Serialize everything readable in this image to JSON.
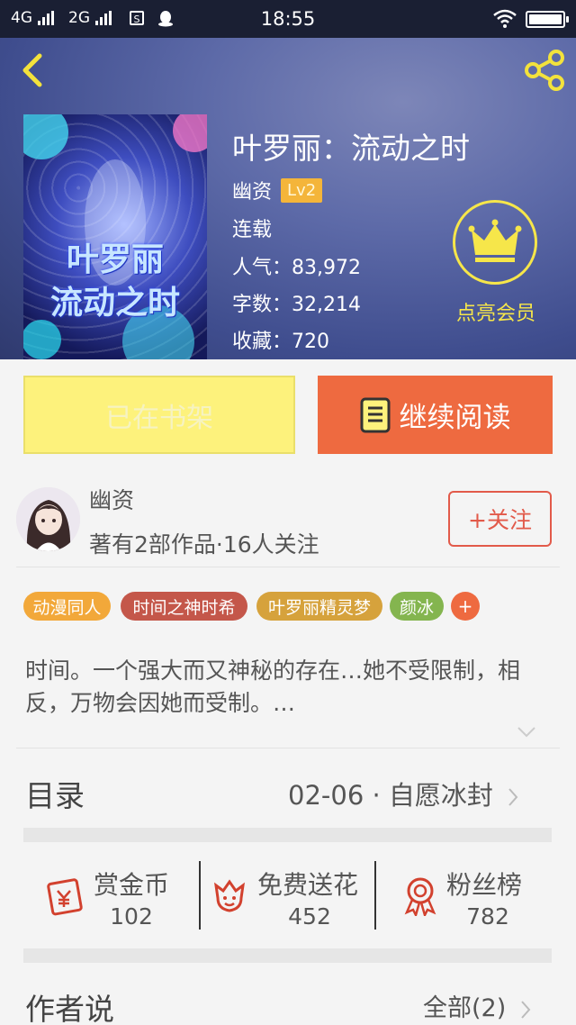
{
  "status_bar": {
    "network1": "4G",
    "network2": "2G",
    "app_icon_letter": "S",
    "time": "18:55"
  },
  "book": {
    "title": "叶罗丽：流动之时",
    "author": "幽资",
    "author_level": "Lv2",
    "status": "连载",
    "popularity": "人气：83,972",
    "word_count": "字数：32,214",
    "favorites": "收藏：720",
    "cover_text_line1": "叶罗丽",
    "cover_text_line2": "流动之时"
  },
  "vip": {
    "label": "点亮会员",
    "icon": "crown-icon"
  },
  "actions": {
    "shelf_label": "已在书架",
    "read_label": "继续阅读"
  },
  "author_card": {
    "name": "幽资",
    "summary": "著有2部作品·16人关注",
    "follow_label": "+关注"
  },
  "tags": [
    "动漫同人",
    "时间之神时希",
    "叶罗丽精灵梦",
    "颜冰"
  ],
  "tag_add": "+",
  "colors": {
    "tag1": "#f2a83a",
    "tag2": "#c4574a",
    "tag3": "#d6a23c",
    "tag4": "#84b54f",
    "accent": "#ee6a40",
    "shelf": "#fdf27c"
  },
  "description": "时间。一个强大而又神秘的存在…她不受限制，相反，万物会因她而受制。…",
  "toc": {
    "label": "目录",
    "latest": "02-06 · 自愿冰封"
  },
  "stats": [
    {
      "label": "赏金币",
      "value": "102",
      "icon": "coin-envelope-icon"
    },
    {
      "label": "免费送花",
      "value": "452",
      "icon": "flower-icon"
    },
    {
      "label": "粉丝榜",
      "value": "782",
      "icon": "medal-icon"
    }
  ],
  "author_says": {
    "label": "作者说",
    "all_label": "全部(2)"
  }
}
